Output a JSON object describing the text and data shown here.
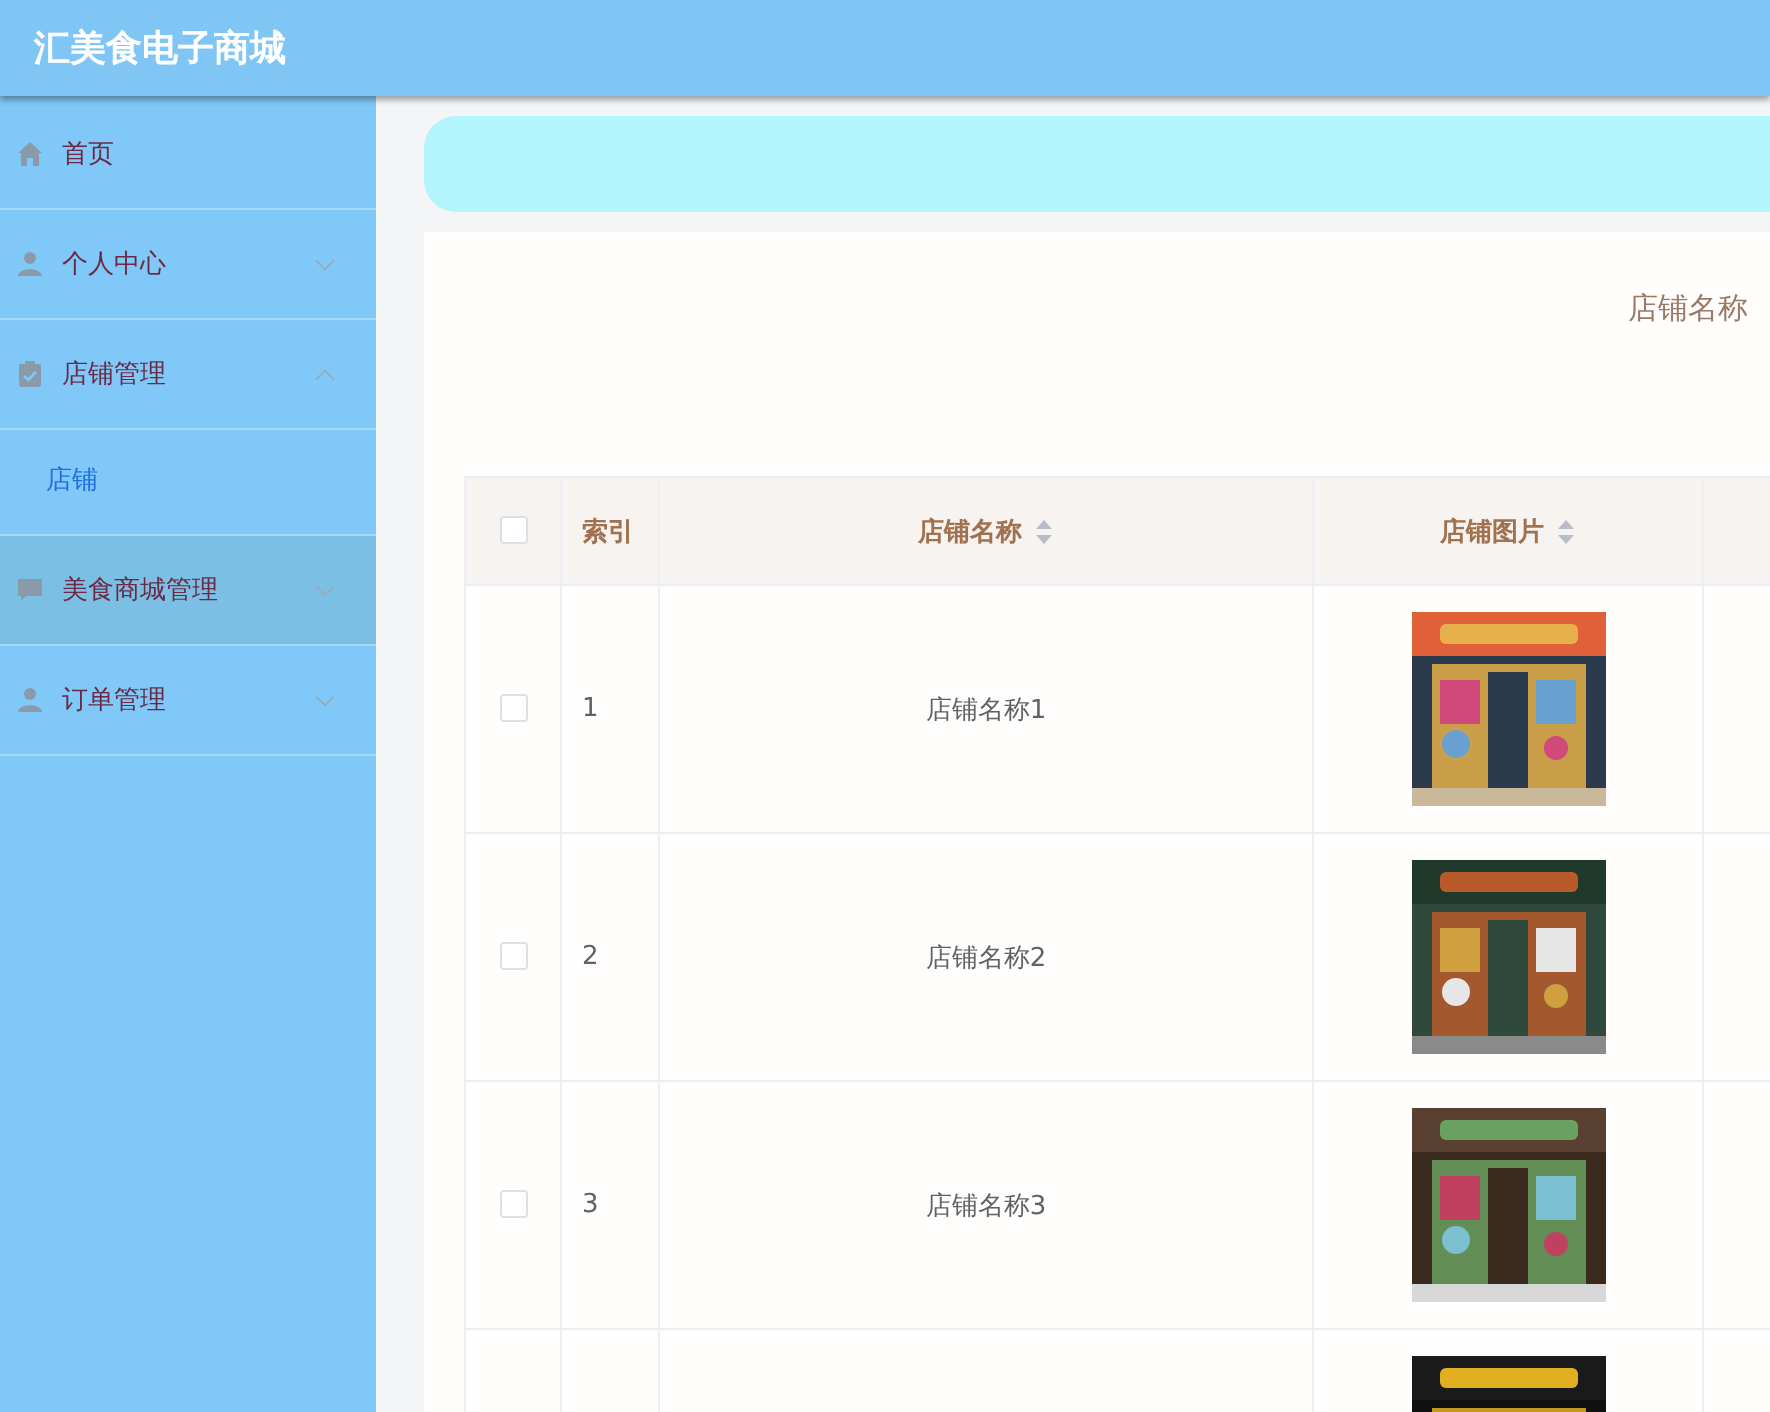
{
  "header": {
    "title": "汇美食电子商城"
  },
  "sidebar": {
    "items": [
      {
        "label": "首页",
        "kind": "item",
        "hovered": false
      },
      {
        "label": "个人中心",
        "kind": "submenu",
        "expanded": false,
        "hovered": false
      },
      {
        "label": "店铺管理",
        "kind": "submenu",
        "expanded": true,
        "hovered": false,
        "children": [
          {
            "label": "店铺",
            "selected": true
          }
        ]
      },
      {
        "label": "美食商城管理",
        "kind": "submenu",
        "expanded": false,
        "hovered": true
      },
      {
        "label": "订单管理",
        "kind": "submenu",
        "expanded": false,
        "hovered": false
      }
    ]
  },
  "search": {
    "label": "店铺名称"
  },
  "table": {
    "header_checked": false,
    "columns": [
      {
        "label": "索引",
        "sortable": false
      },
      {
        "label": "店铺名称",
        "sortable": true
      },
      {
        "label": "店铺图片",
        "sortable": true
      }
    ],
    "rows": [
      {
        "checked": false,
        "index": "1",
        "name": "店铺名称1",
        "image": {
          "kind": "picture"
        }
      },
      {
        "checked": false,
        "index": "2",
        "name": "店铺名称2",
        "image": {
          "kind": "picture"
        }
      },
      {
        "checked": false,
        "index": "3",
        "name": "店铺名称3",
        "image": {
          "kind": "picture"
        }
      },
      {
        "image": {
          "kind": "picture"
        }
      }
    ]
  }
}
